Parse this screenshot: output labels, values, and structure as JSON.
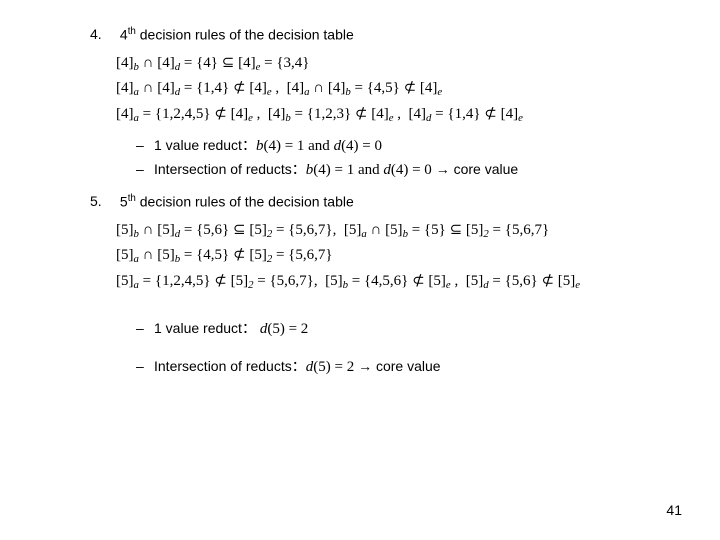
{
  "item4": {
    "num": "4.",
    "title_pre": "4",
    "title_sup": "th",
    "title_rest": " decision rules of the decision table",
    "math_lines": [
      "[4]ᵦ ∩ [4]_d = {4} ⊆ [4]ₑ = {3,4}",
      "[4]ₐ ∩ [4]_d = {1,4} ⊄ [4]ₑ ,  [4]ₐ ∩ [4]ᵦ = {4,5} ⊄ [4]ₑ",
      "[4]ₐ = {1,2,4,5} ⊄ [4]ₑ ,  [4]ᵦ = {1,2,3} ⊄ [4]ₑ ,  [4]_d = {1,4} ⊄ [4]ₑ"
    ],
    "bullet1_text": "1 value reduct：",
    "bullet1_math": "b(4) = 1 and d(4) = 0",
    "bullet2_text": "Intersection of reducts：",
    "bullet2_math": "b(4) = 1 and d(4) = 0",
    "bullet2_tail": " → core value"
  },
  "item5": {
    "num": "5.",
    "title_pre": "5",
    "title_sup": "th",
    "title_rest": " decision rules of the decision table",
    "math_lines": [
      "[5]ᵦ ∩ [5]_d = {5,6} ⊆ [5]₂ = {5,6,7},  [5]ₐ ∩ [5]ᵦ = {5} ⊆ [5]₂ = {5,6,7}",
      "[5]ₐ ∩ [5]ᵦ = {4,5} ⊄ [5]₂ = {5,6,7}",
      "[5]ₐ = {1,2,4,5} ⊄ [5]₂ = {5,6,7},  [5]ᵦ = {4,5,6} ⊄ [5]ₑ ,  [5]_d = {5,6} ⊄ [5]ₑ"
    ],
    "bullet1_text": "1 value reduct：",
    "bullet1_math": "d(5) = 2",
    "bullet2_text": "Intersection of reducts：",
    "bullet2_math": "d(5) = 2",
    "bullet2_tail": " → core value"
  },
  "page_number": "41"
}
